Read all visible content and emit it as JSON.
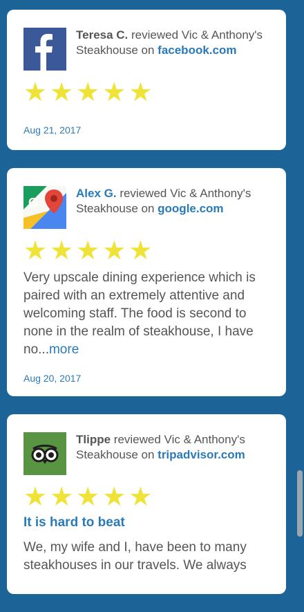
{
  "reviews": [
    {
      "reviewer": "Teresa C.",
      "action": " reviewed Vic & Anthony's Steakhouse on ",
      "site": "facebook.com",
      "source_icon": "facebook-icon",
      "rating": 5,
      "date": "Aug 21, 2017"
    },
    {
      "reviewer": "Alex G.",
      "action": " reviewed Vic & Anthony's Steakhouse on ",
      "site": "google.com",
      "source_icon": "google-maps-icon",
      "rating": 5,
      "text": "Very upscale dining experience which is paired with an extremely attentive and welcoming staff. The food is second to none in the realm of steakhouse, I have no...",
      "more_label": "more",
      "date": "Aug 20, 2017"
    },
    {
      "reviewer": "Tlippe",
      "action": " reviewed Vic & Anthony's Steakhouse on ",
      "site": "tripadvisor.com",
      "source_icon": "tripadvisor-icon",
      "rating": 5,
      "title": "It is hard to beat",
      "text": "We, my wife and I, have been to many steakhouses in our travels. We always"
    }
  ],
  "colors": {
    "background": "#1c6398",
    "link": "#2a7ab8",
    "star": "#efe337",
    "facebook": "#3b5998",
    "tripadvisor": "#589442"
  }
}
